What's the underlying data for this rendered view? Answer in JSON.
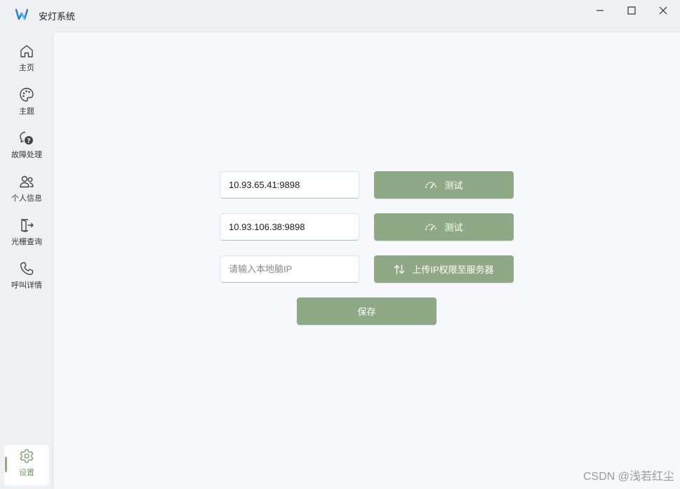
{
  "window": {
    "title": "安灯系统",
    "minimize_icon": "minimize-icon",
    "maximize_icon": "maximize-icon",
    "close_icon": "close-icon"
  },
  "sidebar": {
    "items": [
      {
        "label": "主页",
        "icon": "home-icon"
      },
      {
        "label": "主题",
        "icon": "palette-icon"
      },
      {
        "label": "故障处理",
        "icon": "chat-question-icon"
      },
      {
        "label": "个人信息",
        "icon": "people-icon"
      },
      {
        "label": "光栅查询",
        "icon": "door-exit-icon"
      },
      {
        "label": "呼叫详情",
        "icon": "phone-icon"
      }
    ],
    "settings": {
      "label": "设置",
      "icon": "gear-icon",
      "active": true
    }
  },
  "form": {
    "server_ip_1": {
      "value": "10.93.65.41:9898"
    },
    "server_ip_2": {
      "value": "10.93.106.38:9898"
    },
    "local_ip": {
      "value": "",
      "placeholder": "请输入本地脑IP"
    },
    "test_button_1": {
      "label": "测试",
      "icon": "speedometer-icon"
    },
    "test_button_2": {
      "label": "测试",
      "icon": "speedometer-icon"
    },
    "upload_button": {
      "label": "上传IP权限至服务器",
      "icon": "arrow-up-down-icon"
    },
    "save_button": {
      "label": "保存"
    }
  },
  "watermark": "CSDN @浅若红尘",
  "colors": {
    "accent": "#8fa886",
    "content_bg": "#f7f8fb",
    "sidebar_bg": "#eef0f4",
    "settings_label": "#7c9a6e"
  }
}
